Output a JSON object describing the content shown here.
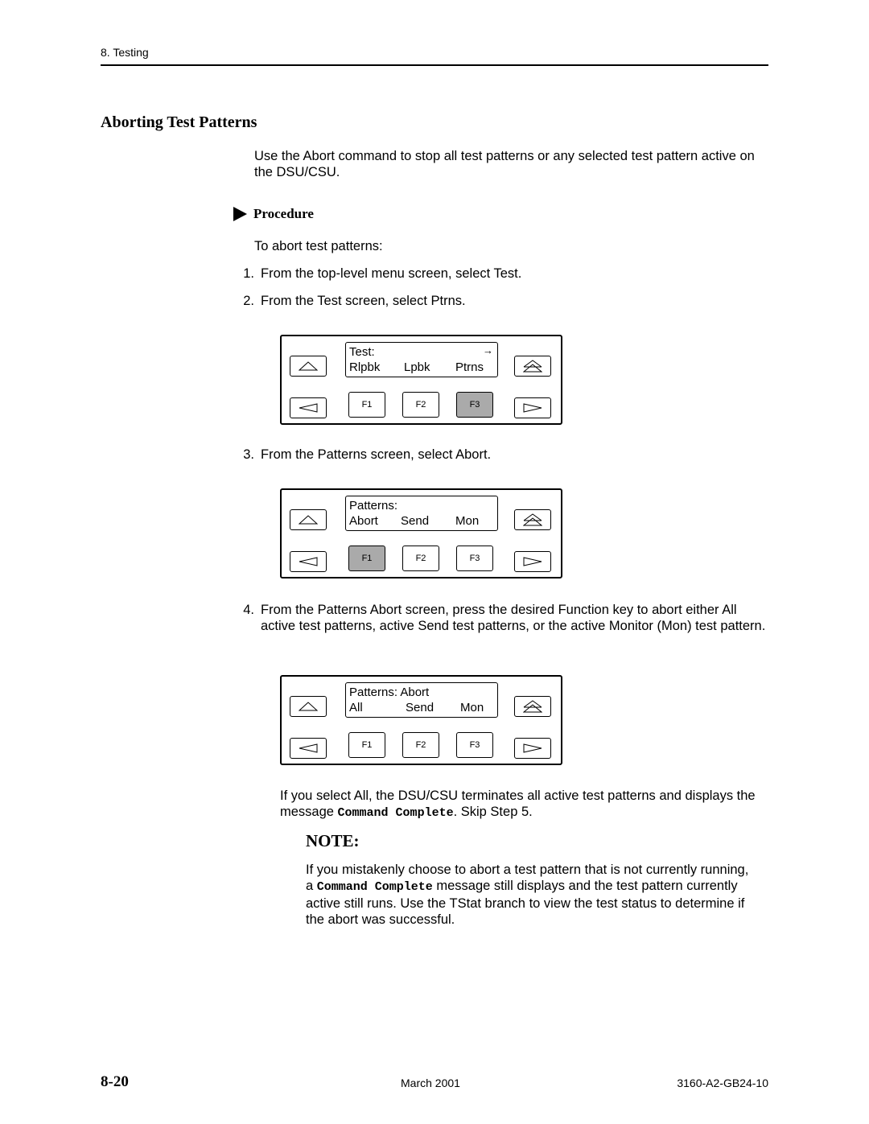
{
  "header": {
    "section": "8. Testing"
  },
  "title": "Aborting Test Patterns",
  "intro": "Use the Abort command to stop all test patterns or any selected test pattern active on the DSU/CSU.",
  "procedure": {
    "label": "Procedure",
    "lead": "To abort test patterns:"
  },
  "steps": [
    {
      "num": "1.",
      "text": "From the top-level menu screen, select Test."
    },
    {
      "num": "2.",
      "text": "From the Test screen, select Ptrns."
    },
    {
      "num": "3.",
      "text": "From the Patterns screen, select Abort."
    },
    {
      "num": "4.",
      "text": "From the Patterns Abort screen, press the desired Function key to abort either All active test patterns, active Send test patterns, or the active Monitor (Mon) test pattern."
    }
  ],
  "panels": [
    {
      "line1": "Test:",
      "opts": [
        "Rlpbk",
        "Lpbk",
        "Ptrns"
      ],
      "more_arrow": "→",
      "selected": "F3"
    },
    {
      "line1": "Patterns:",
      "opts": [
        "Abort",
        "Send",
        "Mon"
      ],
      "selected": "F1"
    },
    {
      "line1": "Patterns: Abort",
      "opts": [
        "All",
        "Send",
        "Mon"
      ],
      "selected": ""
    }
  ],
  "keys": {
    "f1": "F1",
    "f2": "F2",
    "f3": "F3"
  },
  "after": {
    "pre": "If you select All, the DSU/CSU terminates all active test patterns and displays the message ",
    "code": "Command Complete",
    "post": ". Skip Step 5."
  },
  "note": {
    "title": "NOTE:",
    "pre": "If you mistakenly choose to abort a test pattern that is not currently running, a ",
    "code": "Command Complete",
    "post": " message still displays and the test pattern currently active still runs. Use the TStat branch to view the test status to determine if the abort was successful."
  },
  "footer": {
    "page": "8-20",
    "date": "March 2001",
    "doc": "3160-A2-GB24-10"
  }
}
